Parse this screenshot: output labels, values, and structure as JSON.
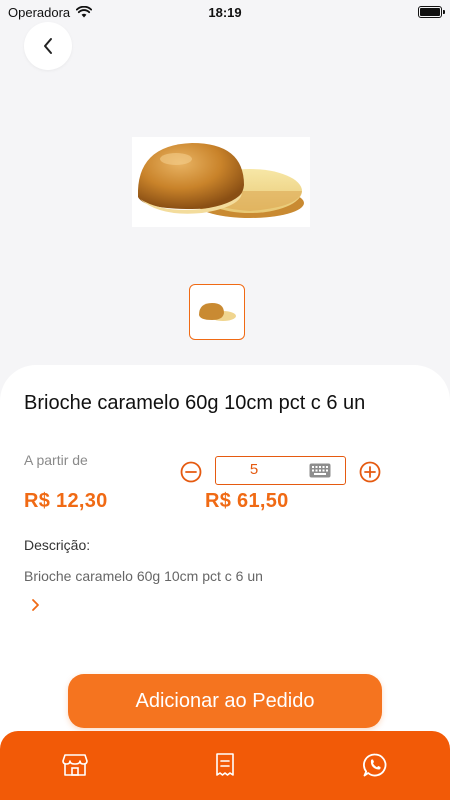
{
  "status_bar": {
    "carrier": "Operadora",
    "time": "18:19"
  },
  "product": {
    "title": "Brioche caramelo 60g 10cm pct c 6 un",
    "from_label": "A partir de",
    "unit_price": "R$ 12,30",
    "total_price": "R$ 61,50",
    "quantity": "5",
    "description_label": "Descrição:",
    "description": "Brioche caramelo 60g 10cm pct c 6 un"
  },
  "actions": {
    "add_to_order": "Adicionar ao Pedido"
  },
  "bottom_nav": {
    "items": [
      "store-icon",
      "receipt-icon",
      "whatsapp-icon"
    ]
  },
  "colors": {
    "accent": "#f06a14",
    "nav_bg": "#f25a07",
    "button_bg": "#f5741f"
  }
}
